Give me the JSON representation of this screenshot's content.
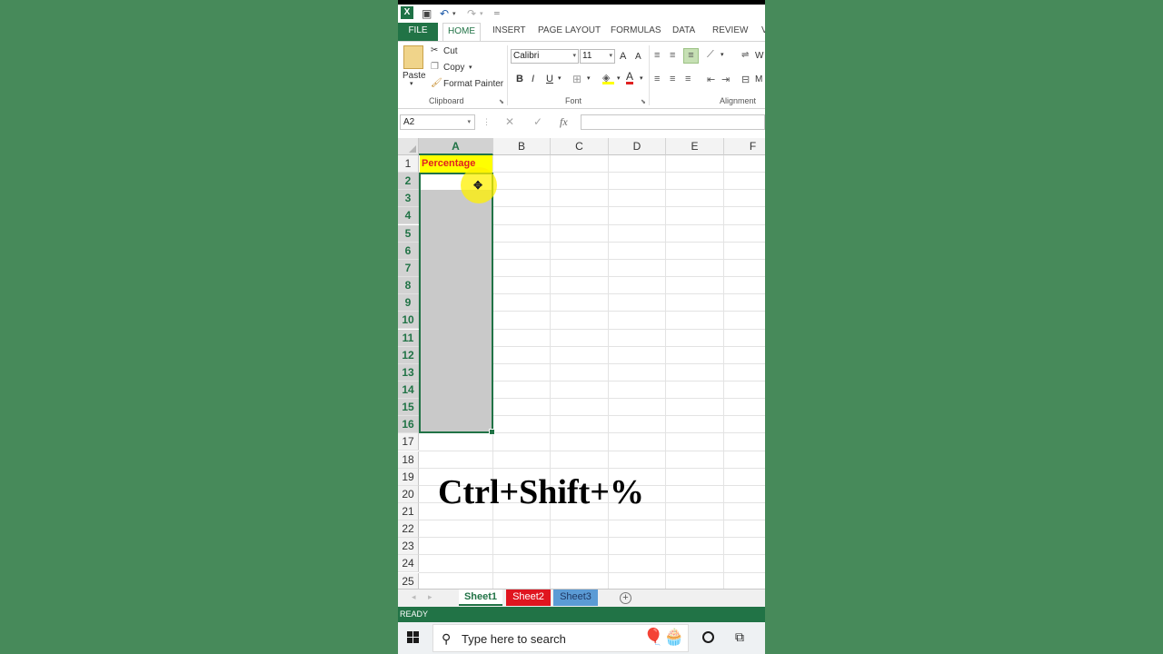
{
  "quick_access": {
    "app_icon": "X",
    "save_icon": "save-icon",
    "undo_icon": "undo-icon",
    "redo_icon": "redo-icon"
  },
  "tabs": [
    "FILE",
    "HOME",
    "INSERT",
    "PAGE LAYOUT",
    "FORMULAS",
    "DATA",
    "REVIEW",
    "V"
  ],
  "ribbon": {
    "paste": "Paste",
    "cut": "Cut",
    "copy": "Copy",
    "format_painter": "Format Painter",
    "clipboard": "Clipboard",
    "font_name": "Calibri",
    "font_size": "11",
    "grow": "A",
    "shrink": "A",
    "bold": "B",
    "italic": "I",
    "underline": "U",
    "font_color": "A",
    "font": "Font",
    "wrap": "W",
    "merge": "M",
    "alignment": "Alignment"
  },
  "formula_bar": {
    "name_box": "A2",
    "cancel": "✕",
    "enter": "✓",
    "fx": "fx",
    "value": ""
  },
  "columns": [
    "A",
    "B",
    "C",
    "D",
    "E",
    "F"
  ],
  "rows": [
    "1",
    "2",
    "3",
    "4",
    "5",
    "6",
    "7",
    "8",
    "9",
    "10",
    "11",
    "12",
    "13",
    "14",
    "15",
    "16",
    "17",
    "18",
    "19",
    "20",
    "21",
    "22",
    "23",
    "24",
    "25"
  ],
  "cells": {
    "A1": "Percentage"
  },
  "overlay_text": "Ctrl+Shift+%",
  "sheet_tabs": [
    {
      "label": "Sheet1",
      "color": "#ffffff",
      "text_color": "#217346"
    },
    {
      "label": "Sheet2",
      "color": "#e0151f",
      "text_color": "#ffffff"
    },
    {
      "label": "Sheet3",
      "color": "#5b9bd5",
      "text_color": "#1f3864"
    }
  ],
  "add_sheet": "+",
  "status": "READY",
  "taskbar": {
    "search_placeholder": "Type here to search",
    "decoration": "🎈🧁"
  },
  "colors": {
    "accent": "#217346",
    "background": "#478a5a",
    "highlight": "#ffff00"
  }
}
